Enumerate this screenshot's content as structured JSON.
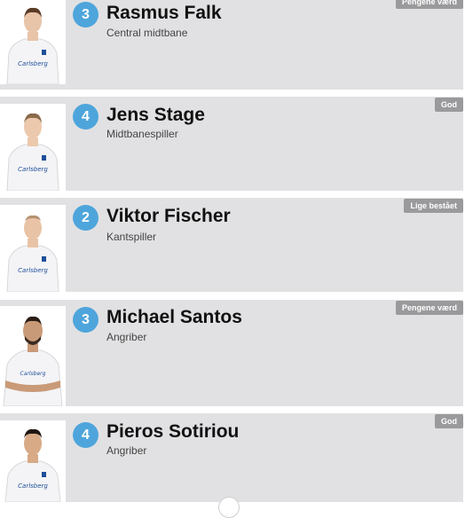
{
  "players": [
    {
      "rating": "3",
      "name": "Rasmus Falk",
      "position": "Central midtbane",
      "badge": "Pengene værd",
      "photo_icon": "player-photo"
    },
    {
      "rating": "4",
      "name": "Jens Stage",
      "position": "Midtbanespiller",
      "badge": "God",
      "photo_icon": "player-photo"
    },
    {
      "rating": "2",
      "name": "Viktor Fischer",
      "position": "Kantspiller",
      "badge": "Lige bestået",
      "photo_icon": "player-photo"
    },
    {
      "rating": "3",
      "name": "Michael Santos",
      "position": "Angriber",
      "badge": "Pengene værd",
      "photo_icon": "player-photo"
    },
    {
      "rating": "4",
      "name": "Pieros Sotiriou",
      "position": "Angriber",
      "badge": "God",
      "photo_icon": "player-photo"
    }
  ],
  "colors": {
    "card_bg": "#e1e1e3",
    "rating_circle": "#4ea5dc",
    "badge_bg": "#9a9a9c",
    "jersey_text": "#1f4f9a"
  }
}
